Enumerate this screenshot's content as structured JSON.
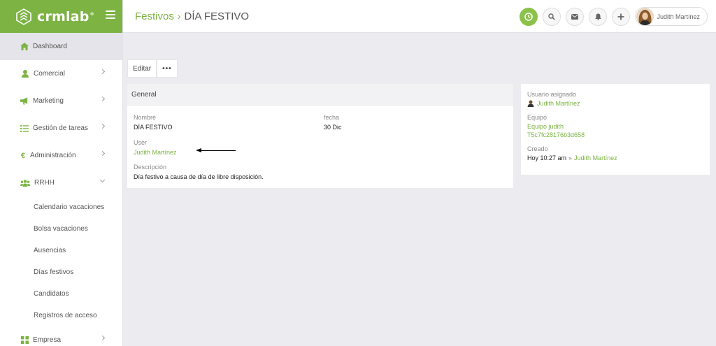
{
  "brand": {
    "name": "crmlab",
    "reg": "®",
    "color": "#7cb342"
  },
  "sidebar": {
    "items": [
      {
        "label": "Dashboard",
        "icon": "home-icon"
      },
      {
        "label": "Comercial",
        "icon": "user-icon"
      },
      {
        "label": "Marketing",
        "icon": "megaphone-icon"
      },
      {
        "label": "Gestión de tareas",
        "icon": "tasks-icon"
      },
      {
        "label": "Administración",
        "icon": "euro-icon"
      },
      {
        "label": "RRHH",
        "icon": "users-icon"
      }
    ],
    "subitems": [
      "Calendario vacaciones",
      "Bolsa vacaciones",
      "Ausencias",
      "Días festivos",
      "Candidatos",
      "Registros de acceso"
    ],
    "partial_item": {
      "label": "Empresa",
      "icon": "grid-icon"
    }
  },
  "topbar": {
    "breadcrumb": "Festivos",
    "separator": "›",
    "current": "DÍA FESTIVO",
    "user_name": "Judith Martínez"
  },
  "toolbar": {
    "edit_label": "Editar",
    "more_label": "•••"
  },
  "general": {
    "title": "General",
    "nombre_label": "Nombre",
    "nombre_value": "DÍA FESTIVO",
    "fecha_label": "fecha",
    "fecha_value": "30 Dic",
    "user_label": "User",
    "user_value": "Judith Martínez",
    "descripcion_label": "Descripción",
    "descripcion_value": "Día festivo a causa de día de libre disposición."
  },
  "side": {
    "usuario_label": "Usuario asignado",
    "usuario_value": "Judith Martínez",
    "equipo_label": "Equipo",
    "equipo_value": "Equipo judith",
    "equipo_id": "T5c7fc28176b3d658",
    "creado_label": "Creado",
    "creado_time": "Hoy 10:27 am",
    "creado_sep": "»",
    "creado_by": "Judith Martínez"
  }
}
